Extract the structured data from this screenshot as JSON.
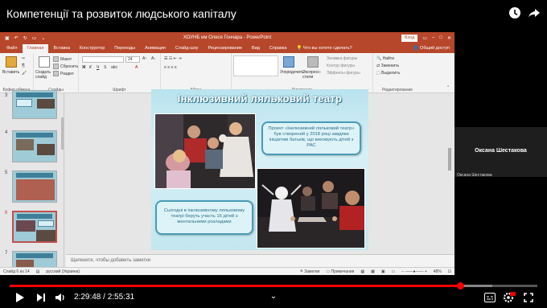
{
  "video": {
    "title": "Компетенції та розвиток людського капіталу",
    "current_time": "2:29:48",
    "separator": "/",
    "duration": "2:55:31",
    "progress_fraction": 0.854
  },
  "ppt": {
    "window_title": "ХОУНБ им Олеся Гончара - PowerPoint",
    "signin_label": "Вход",
    "tabs": [
      "Файл",
      "Главная",
      "Вставка",
      "Конструктор",
      "Переходы",
      "Анимация",
      "Слайд-шоу",
      "Рецензирование",
      "Вид",
      "Справка"
    ],
    "active_tab": "Главная",
    "tell_me": "Что вы хотите сделать?",
    "share_label": "Общий доступ",
    "ribbon": {
      "paste": "Вставить",
      "clipboard": "Буфер обмена",
      "new_slide": "Создать слайд",
      "layout": "Макет",
      "reset": "Сбросить",
      "section": "Раздел",
      "slides": "Слайды",
      "font_size": "24",
      "font_group": "Шрифт",
      "paragraph_group": "Абзац",
      "arrange": "Упорядочить",
      "quick_styles": "Экспресс-стили",
      "shape_fill": "Заливка фигуры",
      "shape_outline": "Контур фигуры",
      "shape_effects": "Эффекты фигуры",
      "drawing_group": "Рисование",
      "find": "Найти",
      "replace": "Заменить",
      "select": "Выделить",
      "editing_group": "Редактирование"
    },
    "thumb_numbers": [
      "3",
      "4",
      "5",
      "6",
      "7"
    ],
    "notes_placeholder": "Щелкните, чтобы добавить заметки",
    "status": {
      "slide_info": "Слайд 6 из 14",
      "language": "русский (Украина)",
      "notes": "Заметки",
      "comments": "Примечания",
      "zoom": "48%"
    }
  },
  "slide": {
    "title": "Інклюзивний ляльковий театр",
    "callout_top": "Проект «Інклюзивний ляльковий театр» був створений у 2018 році завдяки ініціативі батьків, що виховують дітей з РАС",
    "callout_bottom": "Сьогодні в інклюзивному ляльковому театрі беруть участь 16 дітей з ментальними розладами"
  },
  "participant": {
    "name": "Оксана Шестакова",
    "label": "Оксана Шестакова"
  }
}
